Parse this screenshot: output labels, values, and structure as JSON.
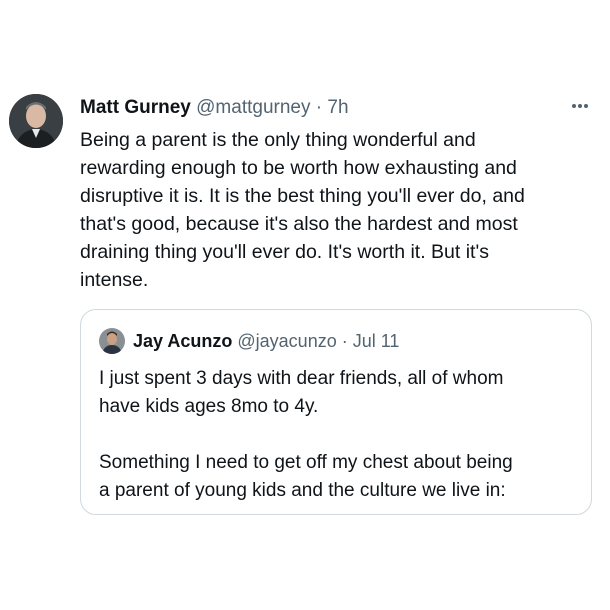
{
  "tweet": {
    "author_name": "Matt Gurney",
    "author_handle": "@mattgurney",
    "separator": "·",
    "time": "7h",
    "more_icon": "more-horizontal-icon",
    "body_lines": [
      "Being a parent is the only thing wonderful and",
      "rewarding enough to be worth how exhausting and",
      "disruptive it is. It is the best thing you'll ever do, and",
      "that's good, because it's also the hardest and most",
      "draining thing you'll ever do. It's worth it. But it's",
      "intense."
    ]
  },
  "quote": {
    "author_name": "Jay Acunzo",
    "author_handle": "@jayacunzo",
    "separator": "·",
    "date": "Jul 11",
    "body_lines_1": [
      "I just spent 3 days with dear friends, all of whom",
      "have kids ages 8mo to 4y."
    ],
    "body_lines_2": [
      "Something I need to get off my chest about being",
      "a parent of young kids and the culture we live in:"
    ]
  },
  "colors": {
    "text_primary": "#0f1419",
    "text_secondary": "#536471",
    "border": "#cfd9de"
  }
}
